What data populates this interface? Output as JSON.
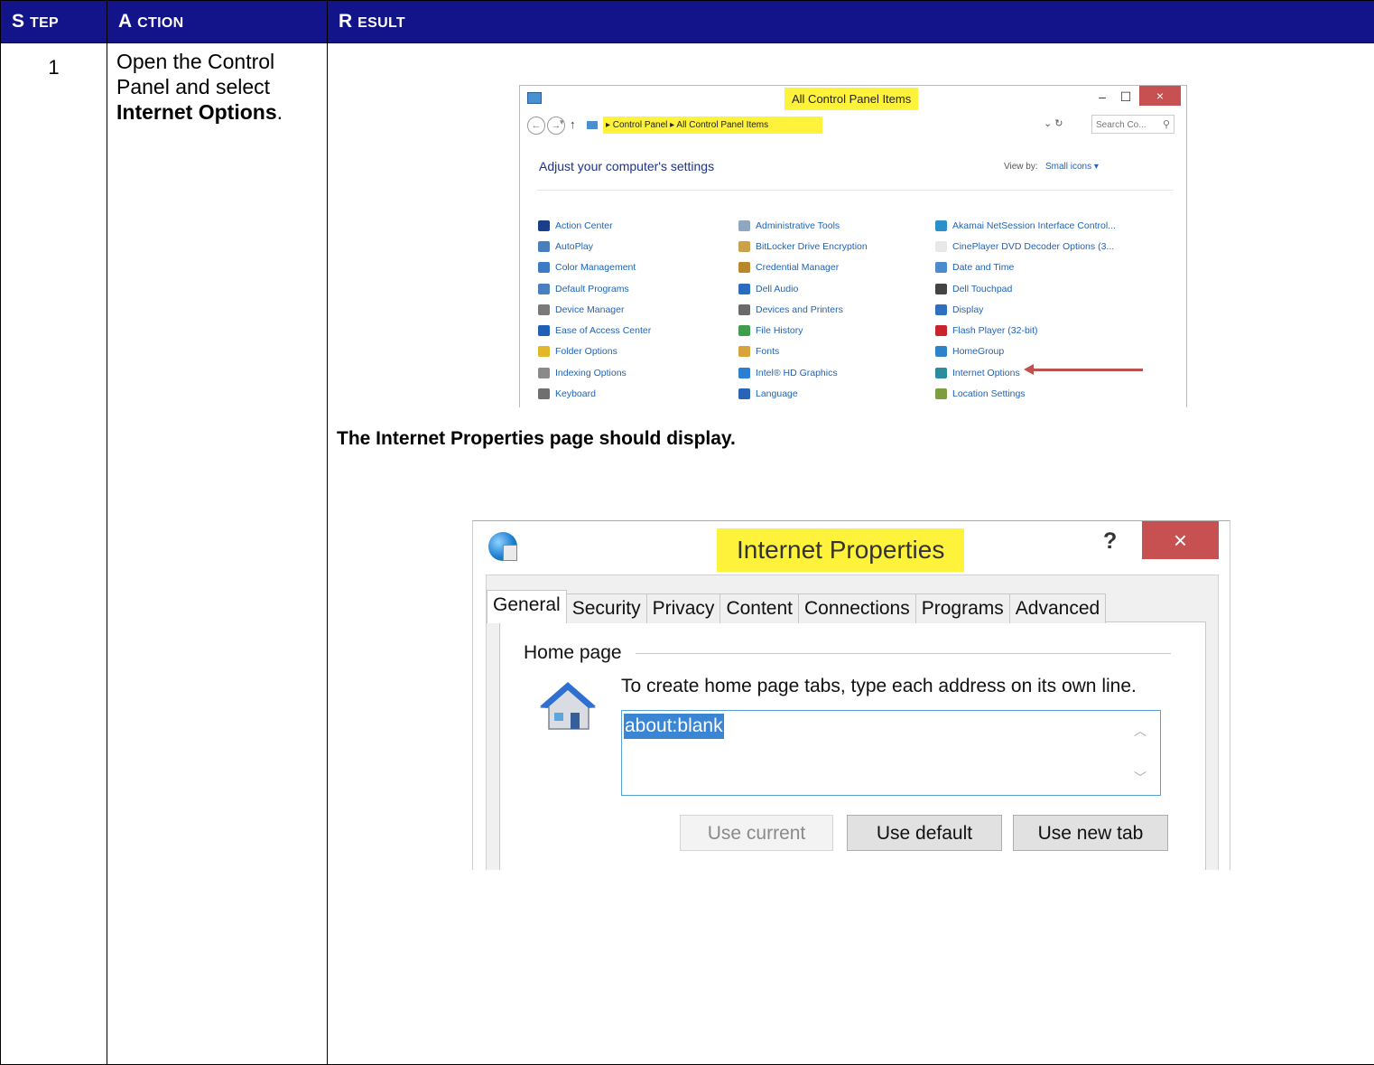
{
  "table": {
    "headers": [
      {
        "first": "S",
        "rest": "TEP"
      },
      {
        "first": "A",
        "rest": "CTION"
      },
      {
        "first": "R",
        "rest": "ESULT"
      }
    ],
    "step": "1",
    "action": {
      "before": "Open the Control Panel and select ",
      "bold": "Internet Options",
      "after": "."
    },
    "caption": "The Internet Properties page should display."
  },
  "control_panel": {
    "title": "All Control Panel Items",
    "window_controls": {
      "minimize": "–",
      "maximize": "☐",
      "close": "×"
    },
    "breadcrumb": "▸  Control Panel  ▸  All Control Panel Items",
    "search_placeholder": "Search Co...",
    "heading": "Adjust your computer's settings",
    "view_by_label": "View by:",
    "view_by_value": "Small icons ▾",
    "columns": [
      [
        {
          "label": "Action Center",
          "color": "#1a3f8a"
        },
        {
          "label": "AutoPlay",
          "color": "#4a7fbf"
        },
        {
          "label": "Color Management",
          "color": "#3e7bc4"
        },
        {
          "label": "Default Programs",
          "color": "#4a7fbf"
        },
        {
          "label": "Device Manager",
          "color": "#7a7a7a"
        },
        {
          "label": "Ease of Access Center",
          "color": "#1f5fb5"
        },
        {
          "label": "Folder Options",
          "color": "#e4b72b"
        },
        {
          "label": "Indexing Options",
          "color": "#8a8a8a"
        },
        {
          "label": "Keyboard",
          "color": "#6f6f6f"
        }
      ],
      [
        {
          "label": "Administrative Tools",
          "color": "#8fa7bf"
        },
        {
          "label": "BitLocker Drive Encryption",
          "color": "#c9a24a"
        },
        {
          "label": "Credential Manager",
          "color": "#b8862b"
        },
        {
          "label": "Dell Audio",
          "color": "#2a6cbf"
        },
        {
          "label": "Devices and Printers",
          "color": "#6a6a6a"
        },
        {
          "label": "File History",
          "color": "#3d9e4d"
        },
        {
          "label": "Fonts",
          "color": "#d8a339"
        },
        {
          "label": "Intel® HD Graphics",
          "color": "#2a7fd2"
        },
        {
          "label": "Language",
          "color": "#2a64b8"
        }
      ],
      [
        {
          "label": "Akamai NetSession Interface Control...",
          "color": "#2b8fc9"
        },
        {
          "label": "CinePlayer DVD Decoder Options (3...",
          "color": "#e8e8e8"
        },
        {
          "label": "Date and Time",
          "color": "#4c8ccc"
        },
        {
          "label": "Dell Touchpad",
          "color": "#444444"
        },
        {
          "label": "Display",
          "color": "#2f6fc1"
        },
        {
          "label": "Flash Player (32-bit)",
          "color": "#c9242b"
        },
        {
          "label": "HomeGroup",
          "color": "#2f82c9"
        },
        {
          "label": "Internet Options",
          "color": "#2a8c9e"
        },
        {
          "label": "Location Settings",
          "color": "#7c9e3f"
        }
      ]
    ]
  },
  "internet_properties": {
    "title": "Internet Properties",
    "help": "?",
    "close": "×",
    "tabs": [
      "General",
      "Security",
      "Privacy",
      "Content",
      "Connections",
      "Programs",
      "Advanced"
    ],
    "group_label": "Home page",
    "hint": "To create home page tabs, type each address on its own line.",
    "home_value": "about:blank",
    "buttons": {
      "use_current": "Use current",
      "use_default": "Use default",
      "use_new_tab": "Use new tab"
    }
  }
}
